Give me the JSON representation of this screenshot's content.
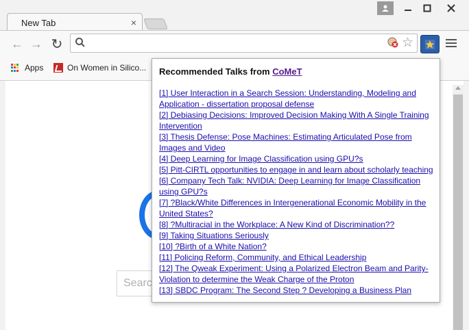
{
  "window": {
    "tab_title": "New Tab",
    "tab_close": "×"
  },
  "toolbar": {
    "back": "←",
    "forward": "→",
    "reload": "↻",
    "omnibox_value": "",
    "star": "☆"
  },
  "bookmarks": [
    {
      "label": "Apps",
      "icon": "apps-grid-icon"
    },
    {
      "label": "On Women in Silico...",
      "icon": "bookmark-favicon"
    }
  ],
  "content": {
    "search_placeholder": "Search"
  },
  "popup": {
    "heading_prefix": "Recommended Talks from ",
    "heading_link": "CoMeT",
    "talks": [
      "[1] User Interaction in a Search Session: Understanding, Modeling and Application - dissertation proposal defense",
      "[2] Debiasing Decisions: Improved Decision Making With A Single Training Intervention",
      "[3] Thesis Defense: Pose Machines: Estimating Articulated Pose from Images and Video",
      "[4] Deep Learning for Image Classification using GPU?s",
      "[5] Pitt-CIRTL opportunities to engage in and learn about scholarly teaching",
      "[6] Company Tech Talk: NVIDIA: Deep Learning for Image Classification using GPU?s",
      "[7] ?Black/White Differences in Intergenerational Economic Mobility in the United States?",
      "[8] ?Multiracial in the Workplace: A New Kind of Discrimination??",
      "[9] Taking Situations Seriously",
      "[10] ?Birth of a White Nation?",
      "[11] Policing Reform, Community, and Ethical Leadership",
      "[12] The Qweak Experiment: Using a Polarized Electron Beam and Parity-Violation to determine the Weak Charge of the Proton",
      "[13] SBDC Program: The Second Step ? Developing a Business Plan"
    ]
  },
  "colors": {
    "link": "#1a0dab",
    "visited_link": "#551a8b",
    "google_blue": "#1a73e8",
    "extension_blue": "#2b5fa8"
  }
}
